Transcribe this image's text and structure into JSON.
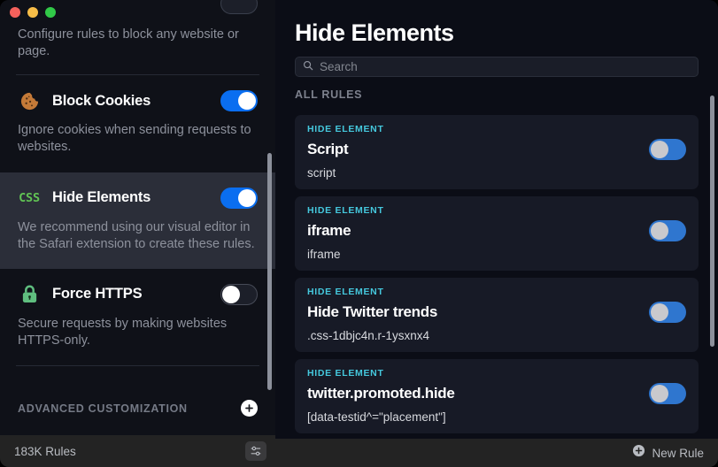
{
  "window": {
    "traffic_lights": [
      {
        "name": "close",
        "color": "#f4615c"
      },
      {
        "name": "minimize",
        "color": "#f7bd48"
      },
      {
        "name": "zoom",
        "color": "#31c948"
      }
    ]
  },
  "sidebar": {
    "top_description": "Configure rules to block any website or page.",
    "rows": [
      {
        "icon": "cookie-icon",
        "title": "Block Cookies",
        "description": "Ignore cookies when sending requests to websites.",
        "toggle_on": true,
        "selected": false
      },
      {
        "icon": "css-badge-icon",
        "icon_text": "CSS",
        "title": "Hide Elements",
        "description": "We recommend using our visual editor in the Safari extension to create these rules.",
        "toggle_on": true,
        "selected": true
      },
      {
        "icon": "lock-icon",
        "title": "Force HTTPS",
        "description": "Secure requests by making websites HTTPS-only.",
        "toggle_on": false,
        "selected": false
      }
    ],
    "advanced_section": {
      "label": "ADVANCED CUSTOMIZATION",
      "add_button_icon": "plus-icon"
    },
    "status": {
      "rules_count": "183K Rules",
      "settings_icon": "sliders-icon"
    }
  },
  "main": {
    "title": "Hide Elements",
    "search": {
      "placeholder": "Search",
      "value": "",
      "icon": "search-icon"
    },
    "section_label": "ALL RULES",
    "cards": [
      {
        "kicker": "HIDE ELEMENT",
        "title": "Script",
        "selector": "script",
        "toggle_on": true
      },
      {
        "kicker": "HIDE ELEMENT",
        "title": "iframe",
        "selector": "iframe",
        "toggle_on": true
      },
      {
        "kicker": "HIDE ELEMENT",
        "title": "Hide Twitter trends",
        "selector": ".css-1dbjc4n.r-1ysxnx4",
        "toggle_on": true
      },
      {
        "kicker": "HIDE ELEMENT",
        "title": "twitter.promoted.hide",
        "selector": "[data-testid^=\"placement\"]",
        "toggle_on": true
      }
    ],
    "bottom_bar": {
      "new_rule_label": "New Rule",
      "new_rule_icon": "plus-circle-icon"
    }
  },
  "colors": {
    "accent_blue": "#0a6ef0",
    "card_toggle_blue": "#2f76cf",
    "kicker_cyan": "#45c8dd",
    "css_green": "#61c454",
    "lock_green": "#5fbe7f",
    "cookie_brown": "#c47a38"
  }
}
